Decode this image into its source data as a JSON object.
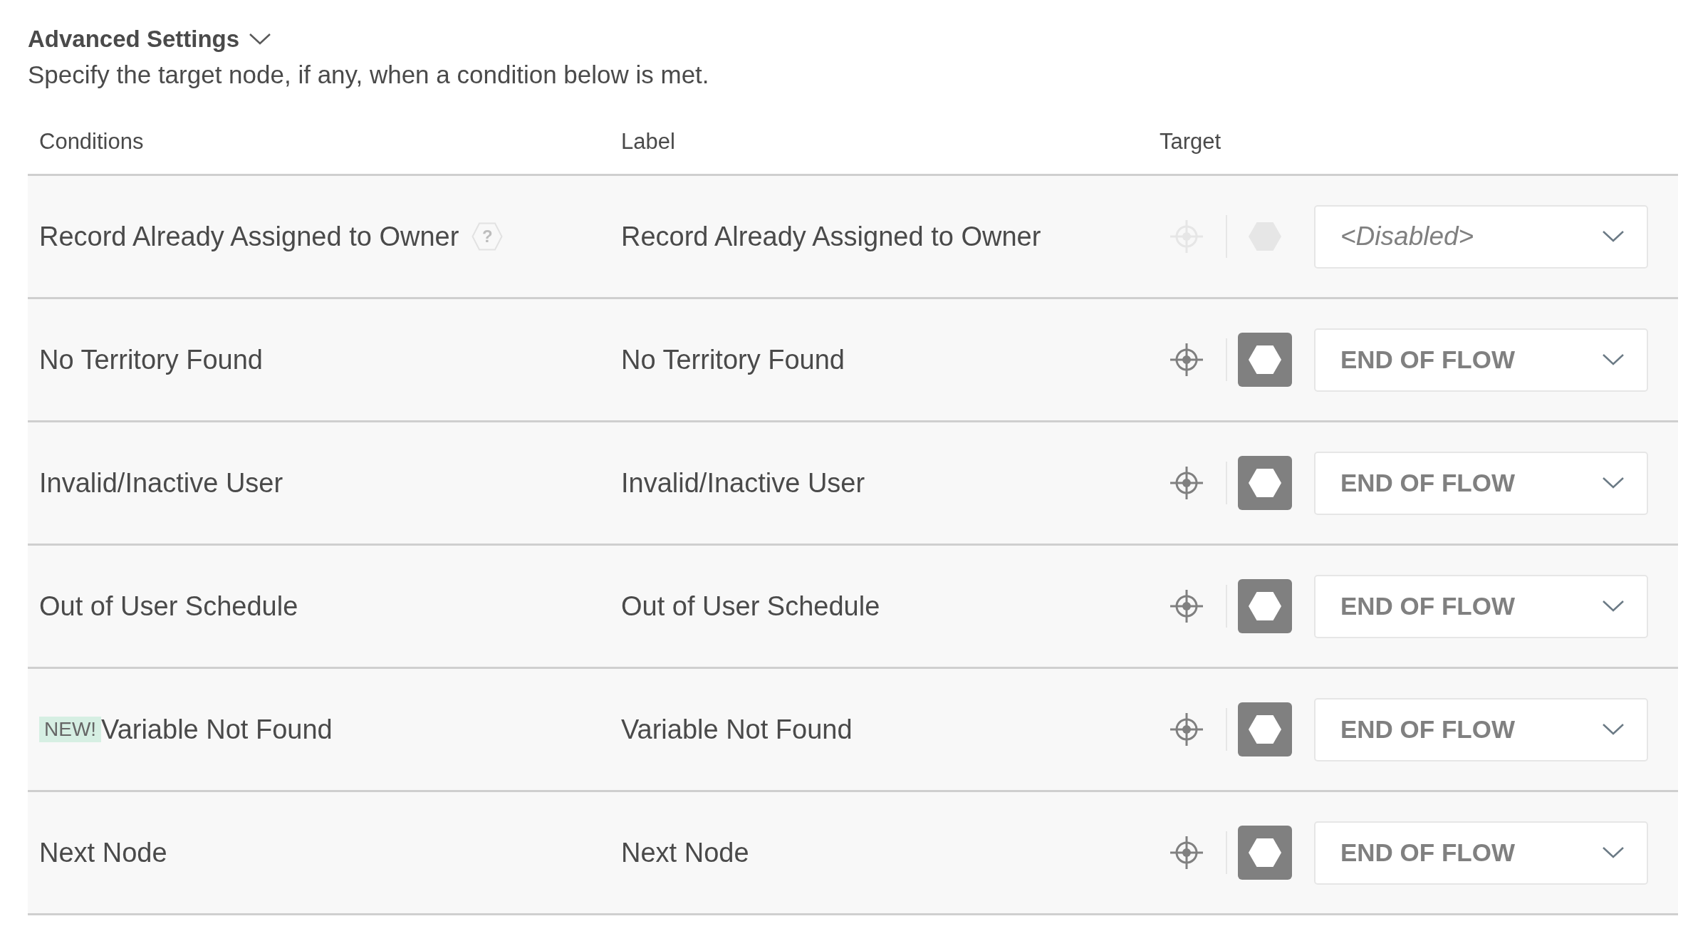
{
  "section": {
    "title": "Advanced Settings",
    "expanded": true,
    "description": "Specify the target node, if any, when a condition below is met."
  },
  "table": {
    "columns": [
      "Conditions",
      "Label",
      "Target"
    ],
    "rows": [
      {
        "condition": "Record Already Assigned to Owner",
        "help_mark": "?",
        "label": "Record Already Assigned to Owner",
        "target": {
          "value": "<Disabled>",
          "disabled": true
        }
      },
      {
        "condition": "No Territory Found",
        "label": "No Territory Found",
        "target": {
          "value": "END OF FLOW",
          "disabled": false
        }
      },
      {
        "condition": "Invalid/Inactive User",
        "label": "Invalid/Inactive User",
        "target": {
          "value": "END OF FLOW",
          "disabled": false
        }
      },
      {
        "condition": "Out of User Schedule",
        "label": "Out of User Schedule",
        "target": {
          "value": "END OF FLOW",
          "disabled": false
        }
      },
      {
        "badge": "NEW!",
        "condition": "Variable Not Found",
        "label": "Variable Not Found",
        "target": {
          "value": "END OF FLOW",
          "disabled": false
        }
      },
      {
        "condition": "Next Node",
        "label": "Next Node",
        "target": {
          "value": "END OF FLOW",
          "disabled": false
        }
      }
    ]
  }
}
